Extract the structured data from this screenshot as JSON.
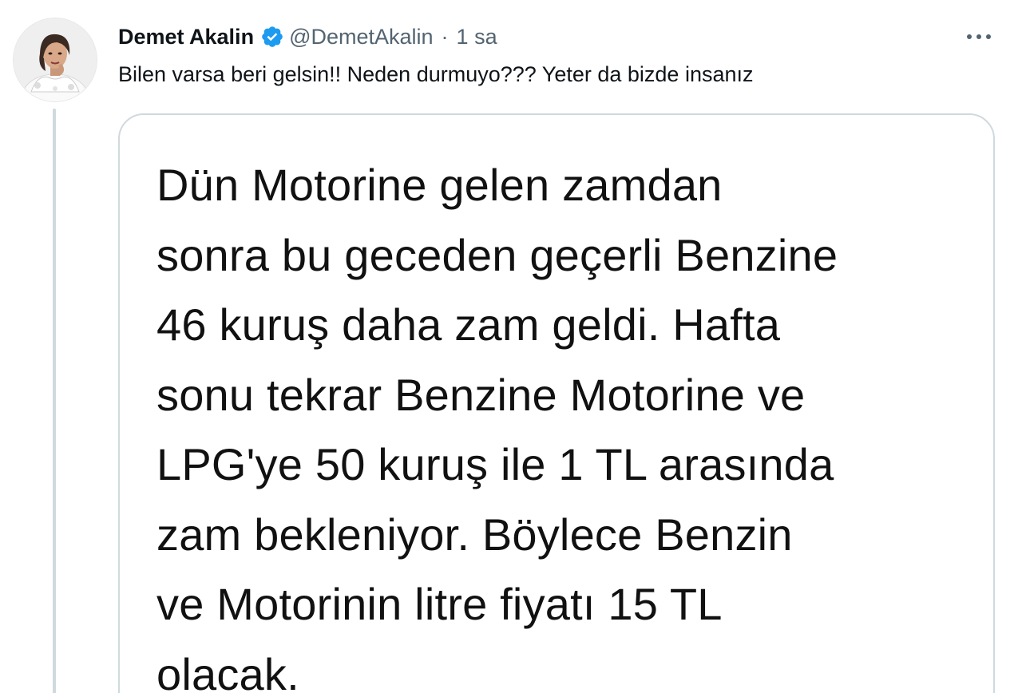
{
  "user": {
    "display_name": "Demet Akalin",
    "handle": "@DemetAkalin",
    "separator": "·",
    "time": "1 sa",
    "verified": true,
    "avatar_icon": "profile-photo"
  },
  "tweet": {
    "text": "Bilen varsa beri gelsin!! Neden durmuyo??? Yeter da bizde insanız"
  },
  "media": {
    "text": "Dün Motorine gelen zamdan\nsonra bu geceden geçerli Benzine\n46 kuruş daha zam geldi. Hafta\nsonu tekrar Benzine Motorine ve\nLPG'ye 50 kuruş ile 1 TL arasında\nzam bekleniyor. Böylece Benzin\nve Motorinin litre fiyatı 15 TL\nolacak."
  },
  "icons": {
    "verified": "verified-badge-icon",
    "more": "more-options-icon"
  },
  "colors": {
    "verified_blue": "#1d9bf0",
    "secondary_text": "#536471",
    "border": "#cfd9de"
  }
}
